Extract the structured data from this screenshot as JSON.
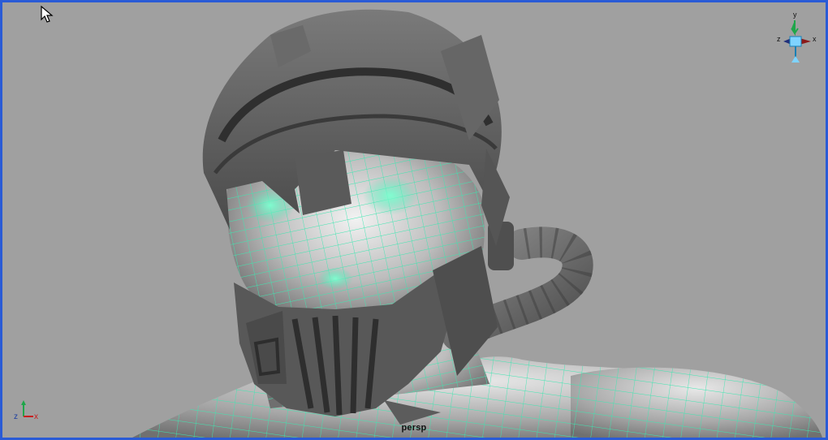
{
  "viewport": {
    "camera_label": "persp",
    "border_color": "#2a5bd6",
    "background_color": "#a0a0a0",
    "wireframe_color": "#3ee6b0",
    "mesh_color": "#5e5e5e"
  },
  "view_cube": {
    "axis_y": "y",
    "axis_x": "x",
    "axis_z": "z"
  },
  "origin_axes": {
    "axis_y": "y",
    "axis_x": "x",
    "axis_z": "z"
  },
  "icons": {
    "cursor": "mouse-cursor-icon",
    "view_cube": "view-cube-icon",
    "axes": "axis-indicator-icon"
  }
}
